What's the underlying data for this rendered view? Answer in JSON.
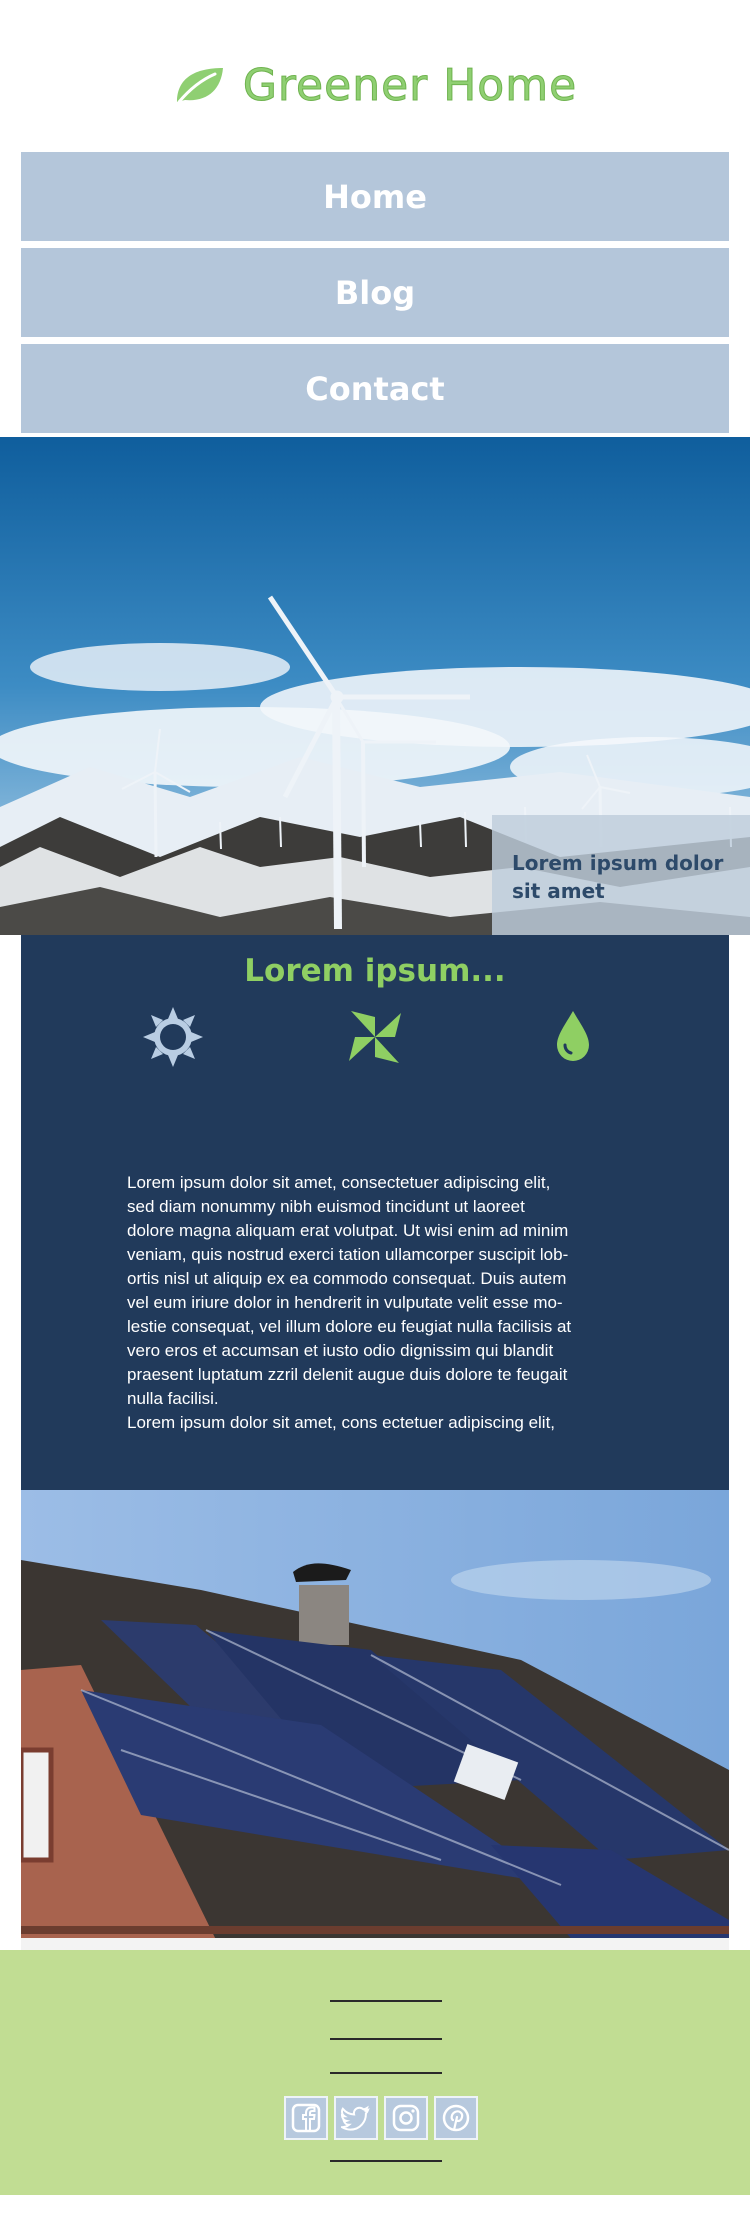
{
  "brand": {
    "name": "Greener Home",
    "icon": "leaf-icon",
    "color": "#8fcf72"
  },
  "nav": {
    "items": [
      "Home",
      "Blog",
      "Contact"
    ]
  },
  "hero": {
    "caption": "Lorem ipsum dolor sit amet",
    "image": "wind-turbines-photo"
  },
  "features": {
    "title": "Lorem ipsum...",
    "icons": [
      "sun-icon",
      "pinwheel-icon",
      "water-drop-icon"
    ],
    "body": "Lorem ipsum dolor sit amet, consectetuer adipiscing elit,\nsed diam nonummy nibh euismod tincidunt ut laoreet\ndolore magna aliquam erat volutpat. Ut wisi enim ad minim\nveniam, quis nostrud exerci tation ullamcorper suscipit lob-\nortis nisl ut aliquip ex ea commodo consequat. Duis autem\nvel eum iriure dolor in hendrerit in vulputate velit esse mo-\nlestie consequat, vel illum dolore eu feugiat nulla facilisis at\nvero eros et accumsan et iusto odio dignissim qui blandit\npraesent luptatum zzril delenit augue duis dolore te feugait\nnulla facilisi.\nLorem ipsum dolor sit amet, cons ectetuer adipiscing elit,"
  },
  "house": {
    "image": "solar-panel-roof-photo"
  },
  "footer": {
    "background": "#c1dd93",
    "social": [
      "facebook-icon",
      "twitter-icon",
      "instagram-icon",
      "pinterest-icon"
    ]
  }
}
